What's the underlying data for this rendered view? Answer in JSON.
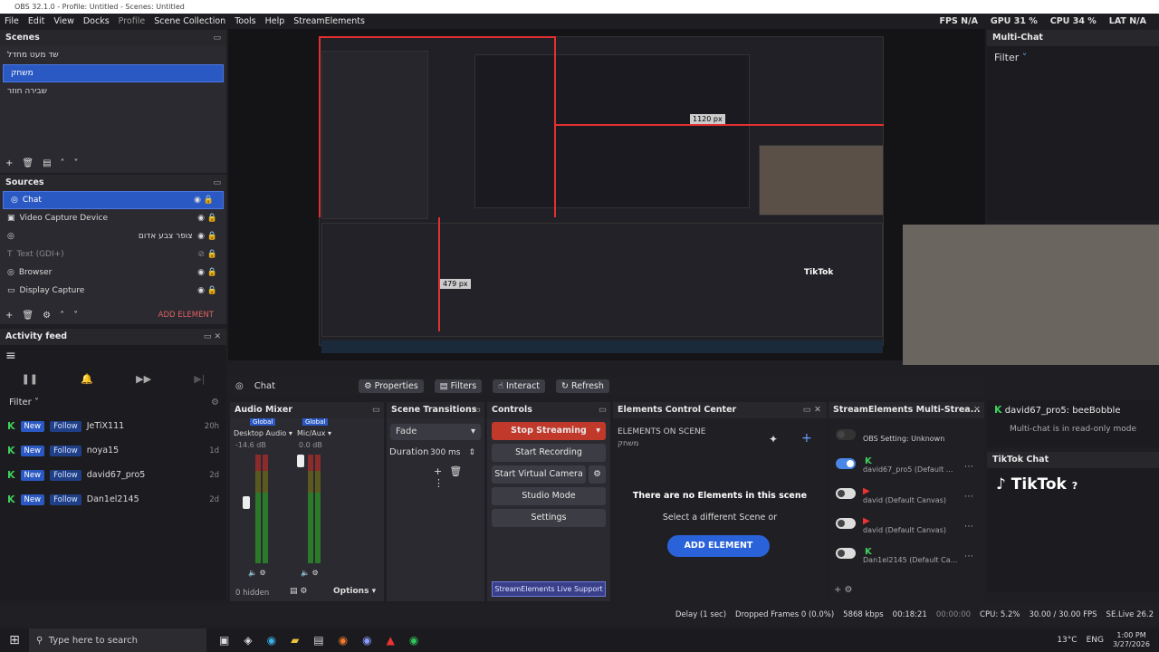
{
  "window": {
    "title": "OBS 32.1.0 - Profile: Untitled - Scenes: Untitled"
  },
  "menu": [
    "File",
    "Edit",
    "View",
    "Docks",
    "Profile",
    "Scene Collection",
    "Tools",
    "Help",
    "StreamElements"
  ],
  "stats": {
    "fps": "FPS N/A",
    "gpu": "GPU 31 %",
    "cpu": "CPU 34 %",
    "lat": "LAT N/A"
  },
  "scenes": {
    "title": "Scenes",
    "items": [
      "שד מעט מחדל",
      "משחק",
      "שבירה חוזר"
    ],
    "selected": 1
  },
  "sources": {
    "title": "Sources",
    "items": [
      {
        "label": "Chat",
        "icon": "chat-icon"
      },
      {
        "label": "Video Capture Device",
        "icon": "camera-icon"
      },
      {
        "label": "צופר צבע אדום",
        "icon": "globe-icon"
      },
      {
        "label": "Text (GDI+)",
        "icon": "text-icon"
      },
      {
        "label": "Browser",
        "icon": "globe-icon"
      },
      {
        "label": "Display Capture",
        "icon": "monitor-icon"
      }
    ],
    "add_element": "ADD ELEMENT"
  },
  "activity": {
    "title": "Activity feed",
    "filter": "Filter",
    "events": [
      {
        "badge1": "New",
        "badge2": "Follow",
        "name": "JeTiX111",
        "age": "20h"
      },
      {
        "badge1": "New",
        "badge2": "Follow",
        "name": "noya15",
        "age": "1d"
      },
      {
        "badge1": "New",
        "badge2": "Follow",
        "name": "david67_pro5",
        "age": "2d"
      },
      {
        "badge1": "New",
        "badge2": "Follow",
        "name": "Dan1el2145",
        "age": "2d"
      }
    ]
  },
  "preview": {
    "dim1": "1120 px",
    "dim2": "479 px",
    "tiktok": "TikTok"
  },
  "source_toolbar": {
    "name": "Chat",
    "properties": "Properties",
    "filters": "Filters",
    "interact": "Interact",
    "refresh": "Refresh"
  },
  "audio": {
    "title": "Audio Mixer",
    "ch1": {
      "tag": "Global",
      "name": "Desktop Audio",
      "db": "-14.6 dB"
    },
    "ch2": {
      "tag": "Global",
      "name": "Mic/Aux",
      "db": "0.0 dB"
    },
    "hidden": "0 hidden",
    "options": "Options"
  },
  "transitions": {
    "title": "Scene Transitions",
    "type": "Fade",
    "duration_label": "Duration",
    "duration": "300 ms"
  },
  "controls": {
    "title": "Controls",
    "stop": "Stop Streaming",
    "record": "Start Recording",
    "virtual": "Start Virtual Camera",
    "studio": "Studio Mode",
    "settings": "Settings",
    "support": "StreamElements Live Support"
  },
  "ecc": {
    "title": "Elements Control Center",
    "on_scene": "ELEMENTS ON SCENE",
    "scene_name": "משחק",
    "none": "There are no Elements in this scene",
    "select": "Select a different Scene or",
    "add": "ADD ELEMENT"
  },
  "multistream": {
    "title": "StreamElements Multi-Strea...",
    "setting": "OBS Setting: Unknown",
    "rows": [
      {
        "name": "david67_pro5 (Default ...",
        "on": true
      },
      {
        "name": "david (Default Canvas)",
        "on": false
      },
      {
        "name": "david (Default Canvas)",
        "on": false
      },
      {
        "name": "Dan1el2145 (Default Ca...",
        "on": false
      }
    ]
  },
  "multichat": {
    "title": "Multi-Chat",
    "filter": "Filter",
    "message": "david67_pro5: beeBobble",
    "readonly": "Multi-chat is in read-only mode"
  },
  "tiktok": {
    "title": "TikTok Chat",
    "brand": "TikTok"
  },
  "status": {
    "delay": "Delay (1 sec)",
    "dropped": "Dropped Frames 0 (0.0%)",
    "kbps": "5868 kbps",
    "time1": "00:18:21",
    "time2": "00:00:00",
    "cpu": "CPU: 5.2%",
    "fps": "30.00 / 30.00 FPS",
    "se": "SE.Live 26.2"
  },
  "taskbar": {
    "search": "Type here to search",
    "weather": "13°C",
    "lang": "ENG",
    "time": "1:00 PM",
    "date": "3/27/2026"
  }
}
